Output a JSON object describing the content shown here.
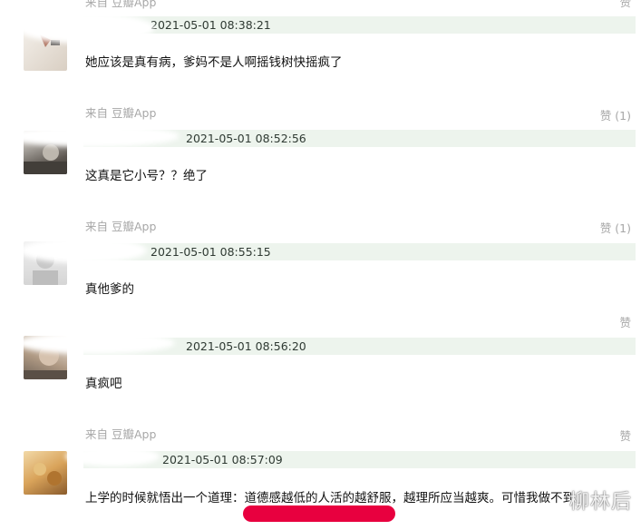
{
  "top_partial": {
    "from_label": "来自 豆瓣App",
    "like_label": "赞"
  },
  "comments": [
    {
      "timestamp": "2021-05-01 08:38:21",
      "text": "她应该是真有病，爹妈不是人啊摇钱树快摇疯了"
    },
    {
      "from_label": "来自 豆瓣App",
      "like_label": "赞 (1)",
      "timestamp": "2021-05-01 08:52:56",
      "text": "这真是它小号？？绝了"
    },
    {
      "from_label": "来自 豆瓣App",
      "like_label": "赞 (1)",
      "timestamp": "2021-05-01 08:55:15",
      "text": "真他爹的"
    },
    {
      "like_label": "赞",
      "timestamp": "2021-05-01 08:56:20",
      "text": "真疯吧"
    },
    {
      "from_label": "来自 豆瓣App",
      "like_label": "赞",
      "timestamp": "2021-05-01 08:57:09",
      "text": "上学的时候就悟出一个道理：道德感越低的人活的越舒服，越理所应当越爽。可惜我做不到"
    }
  ],
  "watermark": "柳林后",
  "colors": {
    "header_bg": "#edf4ed",
    "meta_text": "#a7a7a7",
    "highlight": "#e8003f"
  }
}
